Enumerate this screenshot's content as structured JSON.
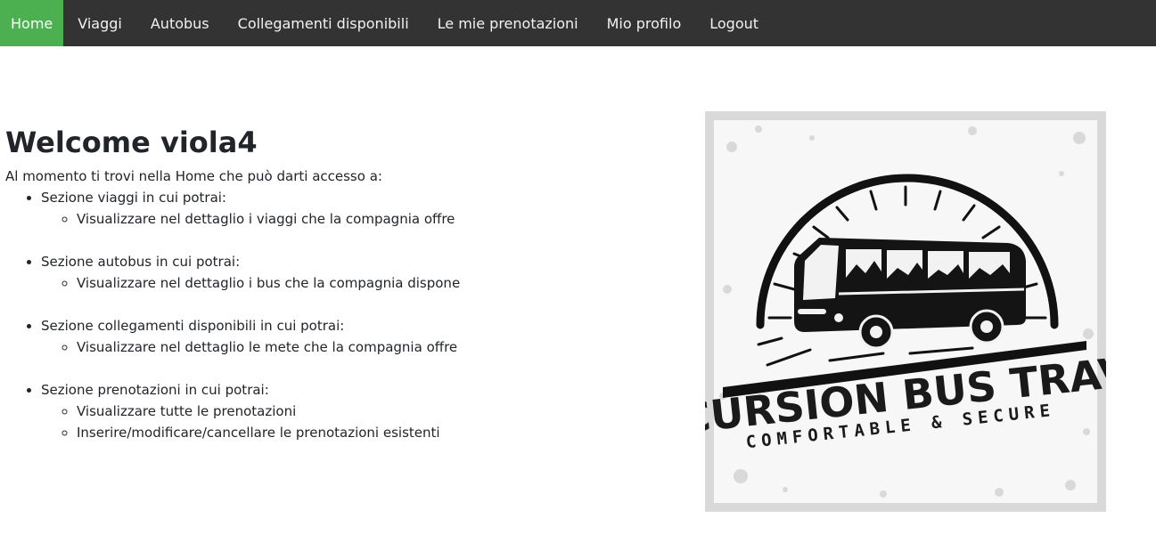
{
  "nav": {
    "items": [
      {
        "label": "Home",
        "active": true
      },
      {
        "label": "Viaggi"
      },
      {
        "label": "Autobus"
      },
      {
        "label": "Collegamenti disponibili"
      },
      {
        "label": "Le mie prenotazioni"
      },
      {
        "label": "Mio profilo"
      },
      {
        "label": "Logout"
      }
    ],
    "bg_color": "#333333",
    "active_color": "#4caf50"
  },
  "main": {
    "title": "Welcome viola4",
    "intro": "Al momento ti trovi nella Home che può darti accesso a:",
    "sections": [
      {
        "label": "Sezione viaggi in cui potrai:",
        "items": [
          "Visualizzare nel dettaglio i viaggi che la compagnia offre"
        ]
      },
      {
        "label": "Sezione autobus in cui potrai:",
        "items": [
          "Visualizzare nel dettaglio i bus che la compagnia dispone"
        ]
      },
      {
        "label": "Sezione collegamenti disponibili in cui potrai:",
        "items": [
          "Visualizzare nel dettaglio le mete che la compagnia offre"
        ]
      },
      {
        "label": "Sezione prenotazioni in cui potrai:",
        "items": [
          "Visualizzare tutte le prenotazioni",
          "Inserire/modificare/cancellare le prenotazioni esistenti"
        ]
      }
    ]
  },
  "logo": {
    "icon": "bus-icon",
    "title": "EXCURSION BUS TRAVEL",
    "subtitle": "COMFORTABLE & SECURE"
  }
}
